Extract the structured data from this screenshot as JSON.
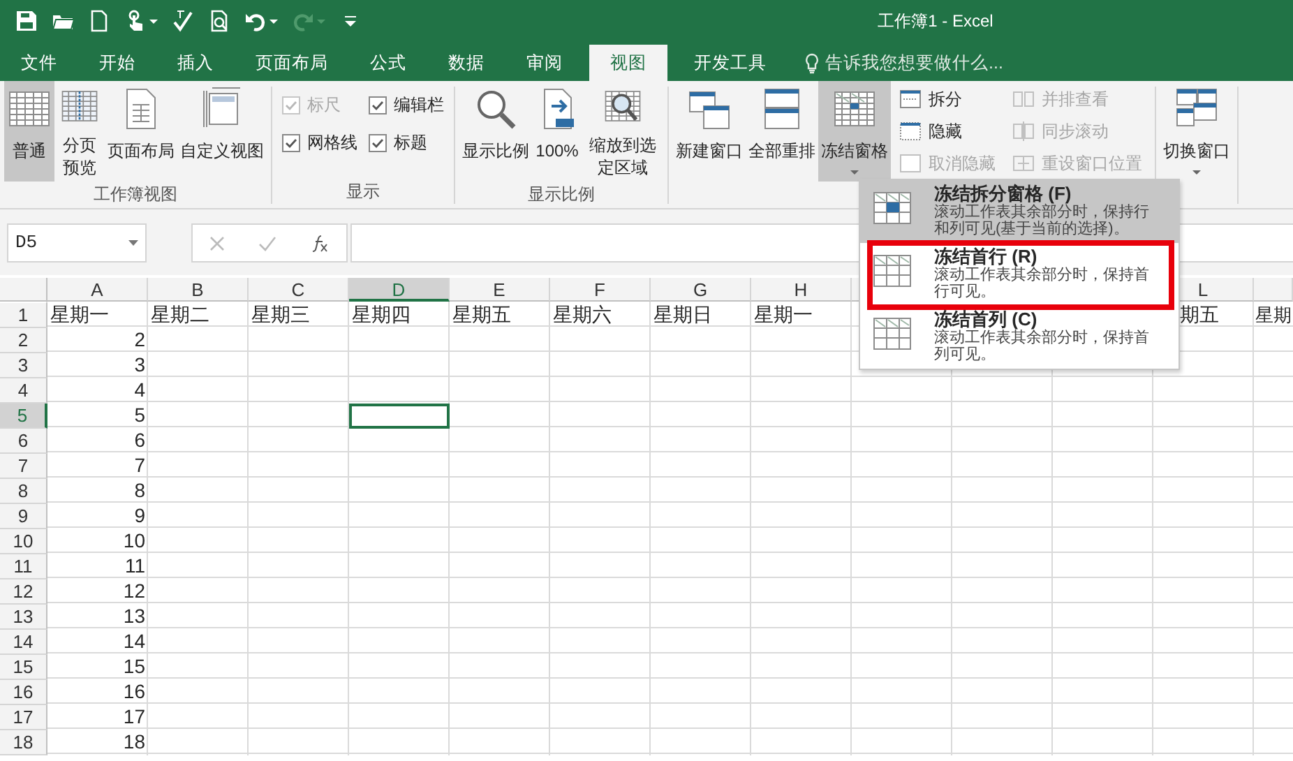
{
  "title_bar": {
    "title": "工作簿1 - Excel"
  },
  "quick_access": [
    {
      "kind": "save",
      "disabled": false
    },
    {
      "kind": "open",
      "disabled": false
    },
    {
      "kind": "new",
      "disabled": false
    },
    {
      "kind": "touch",
      "disabled": false
    },
    {
      "kind": "spelling",
      "disabled": false
    },
    {
      "kind": "preview",
      "disabled": false
    },
    {
      "kind": "undo",
      "disabled": false
    },
    {
      "kind": "redo",
      "disabled": true
    },
    {
      "kind": "customize",
      "disabled": false
    }
  ],
  "tabs": [
    {
      "label": "文件",
      "selected": false
    },
    {
      "label": "开始",
      "selected": false
    },
    {
      "label": "插入",
      "selected": false
    },
    {
      "label": "页面布局",
      "selected": false
    },
    {
      "label": "公式",
      "selected": false
    },
    {
      "label": "数据",
      "selected": false
    },
    {
      "label": "审阅",
      "selected": false
    },
    {
      "label": "视图",
      "selected": true
    },
    {
      "label": "开发工具",
      "selected": false
    }
  ],
  "tell_me": {
    "text": "告诉我您想要做什么..."
  },
  "ribbon": [
    {
      "label": "工作簿视图",
      "columns": [
        {
          "kind": "large",
          "label": "普通",
          "selected": true
        },
        {
          "kind": "large",
          "label": "分页预览",
          "selected": false
        },
        {
          "kind": "large",
          "label": "页面布局",
          "selected": false
        },
        {
          "kind": "large",
          "label": "自定义视图",
          "selected": false
        }
      ]
    },
    {
      "label": "显示",
      "columns": [
        {
          "kind": "checks",
          "items": [
            {
              "label": "标尺",
              "checked": true,
              "disabled": true
            },
            {
              "label": "网格线",
              "checked": true,
              "disabled": false
            }
          ]
        },
        {
          "kind": "checks",
          "items": [
            {
              "label": "编辑栏",
              "checked": true,
              "disabled": false
            },
            {
              "label": "标题",
              "checked": true,
              "disabled": false
            }
          ]
        }
      ]
    },
    {
      "label": "显示比例",
      "columns": [
        {
          "kind": "large",
          "label": "显示比例"
        },
        {
          "kind": "large",
          "label": "100%"
        },
        {
          "kind": "large",
          "label": "缩放到选定区域"
        }
      ]
    },
    {
      "columns": [
        {
          "kind": "large",
          "label": "新建窗口"
        },
        {
          "kind": "large",
          "label": "全部重排"
        },
        {
          "kind": "dropdown",
          "label": "冻结窗格",
          "expanded": true
        },
        {
          "kind": "smalls",
          "items": [
            {
              "label": "拆分",
              "disabled": false
            },
            {
              "label": "隐藏",
              "disabled": false
            },
            {
              "label": "取消隐藏",
              "disabled": true
            }
          ]
        },
        {
          "kind": "smalls",
          "items": [
            {
              "label": "并排查看",
              "disabled": true
            },
            {
              "label": "同步滚动",
              "disabled": true
            },
            {
              "label": "重设窗口位置",
              "disabled": true
            }
          ]
        }
      ]
    },
    {
      "columns": [
        {
          "kind": "dropdown",
          "label": "切换窗口",
          "expanded": false
        }
      ]
    }
  ],
  "name_box": {
    "value": "D5"
  },
  "freeze_menu": [
    {
      "title": "冻结拆分窗格 (F)",
      "description": "滚动工作表其余部分时，保持行和列可见(基于当前的选择)。",
      "hovered": true,
      "highlighted": false
    },
    {
      "title": "冻结首行 (R)",
      "description": "滚动工作表其余部分时，保持首行可见。",
      "hovered": false,
      "highlighted": true
    },
    {
      "title": "冻结首列 (C)",
      "description": "滚动工作表其余部分时，保持首列可见。",
      "hovered": false,
      "highlighted": false
    }
  ],
  "sheet": {
    "columns": [
      {
        "letter": "A",
        "selected": false
      },
      {
        "letter": "B",
        "selected": false
      },
      {
        "letter": "C",
        "selected": false
      },
      {
        "letter": "D",
        "selected": true
      },
      {
        "letter": "E",
        "selected": false
      },
      {
        "letter": "F",
        "selected": false
      },
      {
        "letter": "G",
        "selected": false
      },
      {
        "letter": "H",
        "selected": false
      },
      null,
      null,
      null,
      {
        "letter": "L",
        "selected": false
      },
      null
    ],
    "rows": [
      {
        "header": "1",
        "selected": false,
        "kind": "text",
        "cells": [
          "星期一",
          "星期二",
          "星期三",
          "星期四",
          "星期五",
          "星期六",
          "星期日",
          "星期一",
          null,
          null,
          null,
          "期五",
          "星期"
        ]
      },
      {
        "header": "2",
        "selected": false,
        "kind": "number",
        "cells": [
          "2"
        ]
      },
      {
        "header": "3",
        "selected": false,
        "kind": "number",
        "cells": [
          "3"
        ]
      },
      {
        "header": "4",
        "selected": false,
        "kind": "number",
        "cells": [
          "4"
        ]
      },
      {
        "header": "5",
        "selected": true,
        "kind": "number",
        "cells": [
          "5"
        ]
      },
      {
        "header": "6",
        "selected": false,
        "kind": "number",
        "cells": [
          "6"
        ]
      },
      {
        "header": "7",
        "selected": false,
        "kind": "number",
        "cells": [
          "7"
        ]
      },
      {
        "header": "8",
        "selected": false,
        "kind": "number",
        "cells": [
          "8"
        ]
      },
      {
        "header": "9",
        "selected": false,
        "kind": "number",
        "cells": [
          "9"
        ]
      },
      {
        "header": "10",
        "selected": false,
        "kind": "number",
        "cells": [
          "10"
        ]
      },
      {
        "header": "11",
        "selected": false,
        "kind": "number",
        "cells": [
          "11"
        ]
      },
      {
        "header": "12",
        "selected": false,
        "kind": "number",
        "cells": [
          "12"
        ]
      },
      {
        "header": "13",
        "selected": false,
        "kind": "number",
        "cells": [
          "13"
        ]
      },
      {
        "header": "14",
        "selected": false,
        "kind": "number",
        "cells": [
          "14"
        ]
      },
      {
        "header": "15",
        "selected": false,
        "kind": "number",
        "cells": [
          "15"
        ]
      },
      {
        "header": "16",
        "selected": false,
        "kind": "number",
        "cells": [
          "16"
        ]
      },
      {
        "header": "17",
        "selected": false,
        "kind": "number",
        "cells": [
          "17"
        ]
      },
      {
        "header": "18",
        "selected": false,
        "kind": "number",
        "cells": [
          "18"
        ]
      }
    ]
  }
}
